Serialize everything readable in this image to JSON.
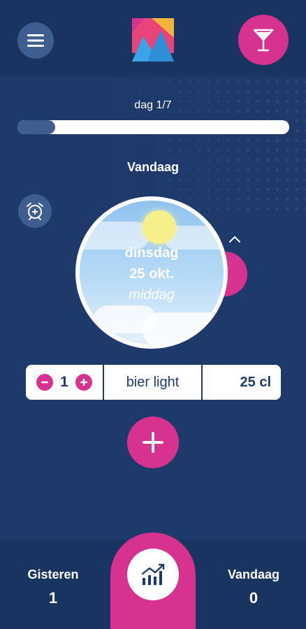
{
  "header": {
    "menu_icon": "hamburger-menu-icon",
    "logo_icon": "app-logo-mountains",
    "drink_icon": "cocktail-glass-icon"
  },
  "progress": {
    "label": "dag 1/7",
    "value": 0.14
  },
  "today": {
    "title": "Vandaag",
    "day": "dinsdag",
    "date": "25 okt.",
    "part_of_day": "middag"
  },
  "entry": {
    "minus_icon": "minus-icon",
    "quantity": "1",
    "plus_icon": "plus-icon",
    "drink": "bier light",
    "volume": "25 cl"
  },
  "bottom": {
    "yesterday_label": "Gisteren",
    "yesterday_value": "1",
    "today_label": "Vandaag",
    "today_value": "0",
    "stats_icon": "chart-trend-icon"
  },
  "colors": {
    "background": "#1e3a6b",
    "bar": "#1a3461",
    "accent": "#d7328f",
    "button": "#3e5e8f"
  }
}
